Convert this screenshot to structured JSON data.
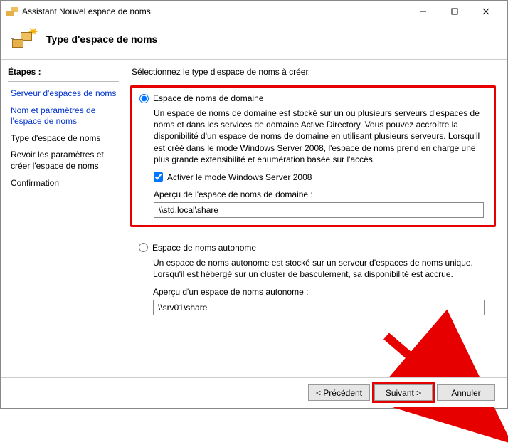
{
  "window": {
    "title": "Assistant Nouvel espace de noms"
  },
  "header": {
    "title": "Type d'espace de noms"
  },
  "sidebar": {
    "heading": "Étapes :",
    "steps": [
      {
        "label": "Serveur d'espaces de noms"
      },
      {
        "label": "Nom et paramètres de l'espace de noms"
      },
      {
        "label": "Type d'espace de noms"
      },
      {
        "label": "Revoir les paramètres et créer l'espace de noms"
      },
      {
        "label": "Confirmation"
      }
    ]
  },
  "main": {
    "intro": "Sélectionnez le type d'espace de noms à créer.",
    "opt_domain": {
      "label": "Espace de noms de domaine",
      "desc": "Un espace de noms de domaine est stocké sur un ou plusieurs serveurs d'espaces de noms et dans les services de domaine Active Directory. Vous pouvez accroître la disponibilité d'un espace de noms de domaine en utilisant plusieurs serveurs. Lorsqu'il est créé dans le mode Windows Server 2008, l'espace de noms prend en charge une plus grande extensibilité et énumération basée sur l'accès.",
      "checkbox": "Activer le mode Windows Server 2008",
      "preview_label": "Aperçu de l'espace de noms de domaine :",
      "preview_value": "\\\\std.local\\share"
    },
    "opt_standalone": {
      "label": "Espace de noms autonome",
      "desc": "Un espace de noms autonome est stocké sur un serveur d'espaces de noms unique. Lorsqu'il est hébergé sur un cluster de basculement, sa disponibilité est accrue.",
      "preview_label": "Aperçu d'un espace de noms autonome :",
      "preview_value": "\\\\srv01\\share"
    }
  },
  "footer": {
    "prev": "< Précédent",
    "next": "Suivant >",
    "cancel": "Annuler"
  }
}
